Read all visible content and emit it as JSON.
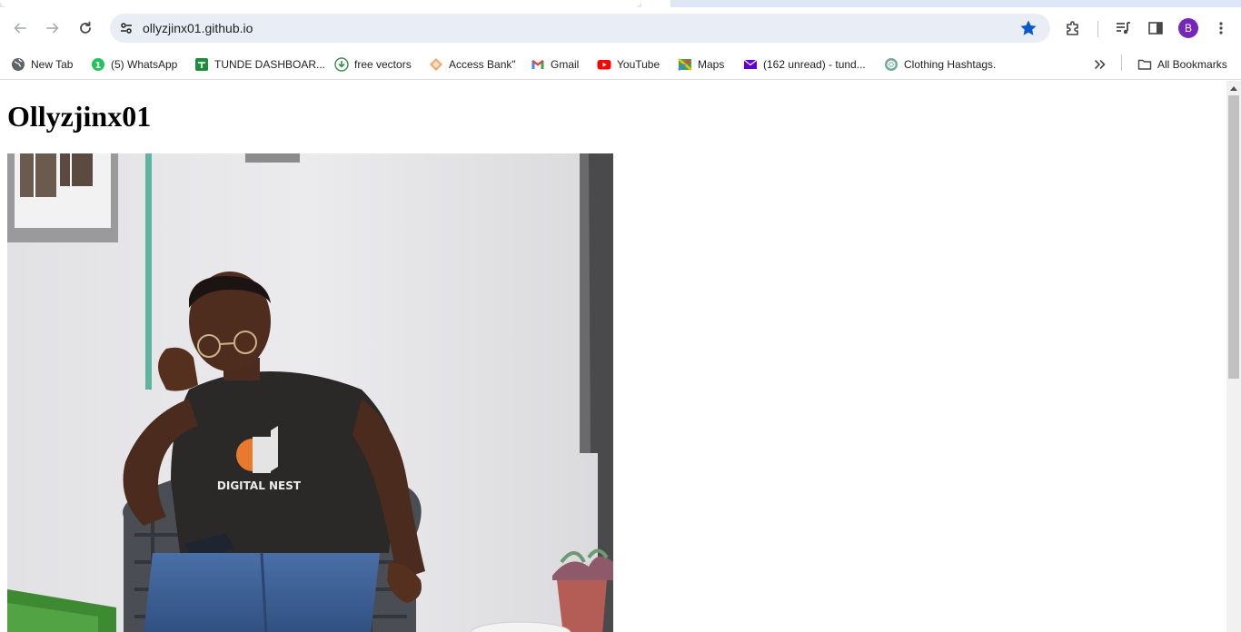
{
  "browser": {
    "url": "ollyzjinx01.github.io",
    "profile_initial": "B",
    "accent_color": "#0b57d0",
    "avatar_color": "#7627bb"
  },
  "bookmarks": [
    {
      "label": "New Tab",
      "icon": "globe-icon"
    },
    {
      "label": "(5) WhatsApp",
      "icon": "whatsapp-icon"
    },
    {
      "label": "TUNDE DASHBOAR...",
      "icon": "sheets-icon"
    },
    {
      "label": "free vectors",
      "icon": "download-icon"
    },
    {
      "label": "Access Bank\"",
      "icon": "diamond-icon"
    },
    {
      "label": "Gmail",
      "icon": "gmail-icon"
    },
    {
      "label": "YouTube",
      "icon": "youtube-icon"
    },
    {
      "label": "Maps",
      "icon": "maps-icon"
    },
    {
      "label": "(162 unread) - tund...",
      "icon": "mail-icon"
    },
    {
      "label": "Clothing Hashtags.",
      "icon": "chatgpt-icon"
    }
  ],
  "all_bookmarks_label": "All Bookmarks",
  "page": {
    "title": "Ollyzjinx01",
    "photo": {
      "shirt_text": "DIGITAL NEST"
    }
  }
}
